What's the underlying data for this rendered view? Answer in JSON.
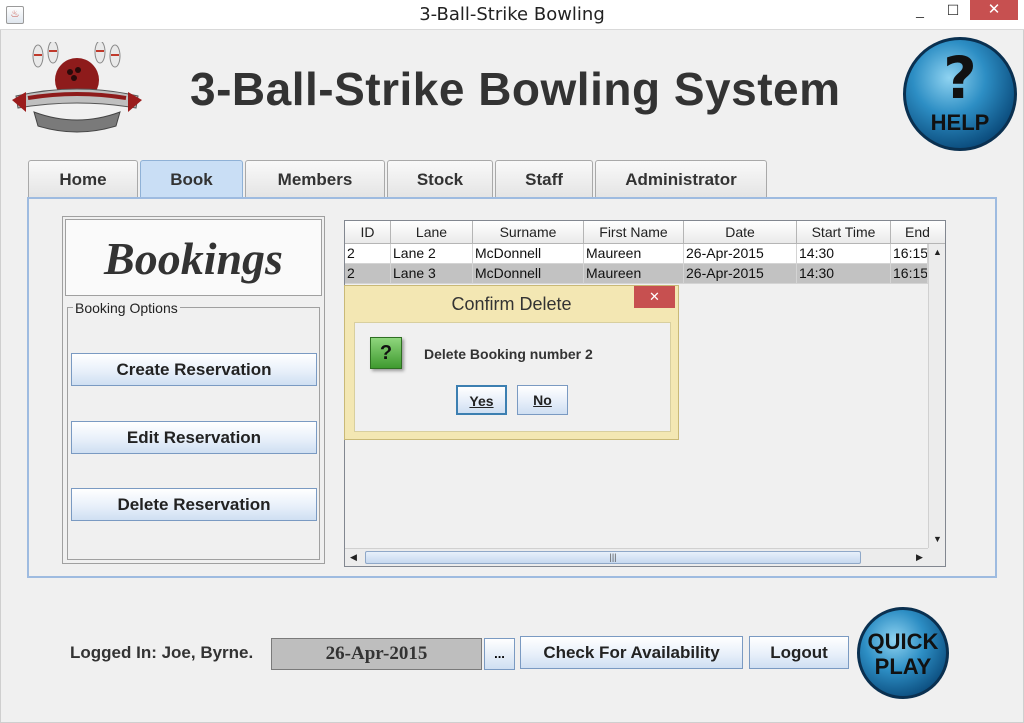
{
  "window": {
    "title": "3-Ball-Strike Bowling",
    "app_icon": "java-icon",
    "minimize": "_",
    "maximize": "☐",
    "close": "✕"
  },
  "header": {
    "title": "3-Ball-Strike Bowling System",
    "help_label": "HELP",
    "help_symbol": "?"
  },
  "tabs": [
    {
      "label": "Home"
    },
    {
      "label": "Book"
    },
    {
      "label": "Members"
    },
    {
      "label": "Stock"
    },
    {
      "label": "Staff"
    },
    {
      "label": "Administrator"
    }
  ],
  "active_tab": "Book",
  "bookings": {
    "heading": "Bookings",
    "options_label": "Booking Options",
    "create": "Create Reservation",
    "edit": "Edit Reservation",
    "delete": "Delete Reservation"
  },
  "table": {
    "columns": [
      "ID",
      "Lane",
      "Surname",
      "First Name",
      "Date",
      "Start Time",
      "End"
    ],
    "rows": [
      {
        "id": "2",
        "lane": "Lane 2",
        "surname": "McDonnell",
        "first": "Maureen",
        "date": "26-Apr-2015",
        "start": "14:30",
        "end": "16:15"
      },
      {
        "id": "2",
        "lane": "Lane 3",
        "surname": "McDonnell",
        "first": "Maureen",
        "date": "26-Apr-2015",
        "start": "14:30",
        "end": "16:15"
      }
    ],
    "selected_row": 1
  },
  "dialog": {
    "title": "Confirm Delete",
    "message": "Delete Booking number 2",
    "yes": "Yes",
    "no": "No",
    "close": "✕",
    "icon": "?"
  },
  "footer": {
    "logged_in": "Logged In: Joe, Byrne.",
    "date": "26-Apr-2015",
    "date_picker": "...",
    "check_availability": "Check For Availability",
    "logout": "Logout",
    "quick_play_line1": "QUICK",
    "quick_play_line2": "PLAY"
  },
  "colors": {
    "active_tab": "#c9def5",
    "panel_border": "#9ebbe0",
    "dialog_frame": "#f3e7b3",
    "close_red": "#c75050",
    "selected_row": "#c2c2c2",
    "help_blue": "#2d8ec4"
  }
}
